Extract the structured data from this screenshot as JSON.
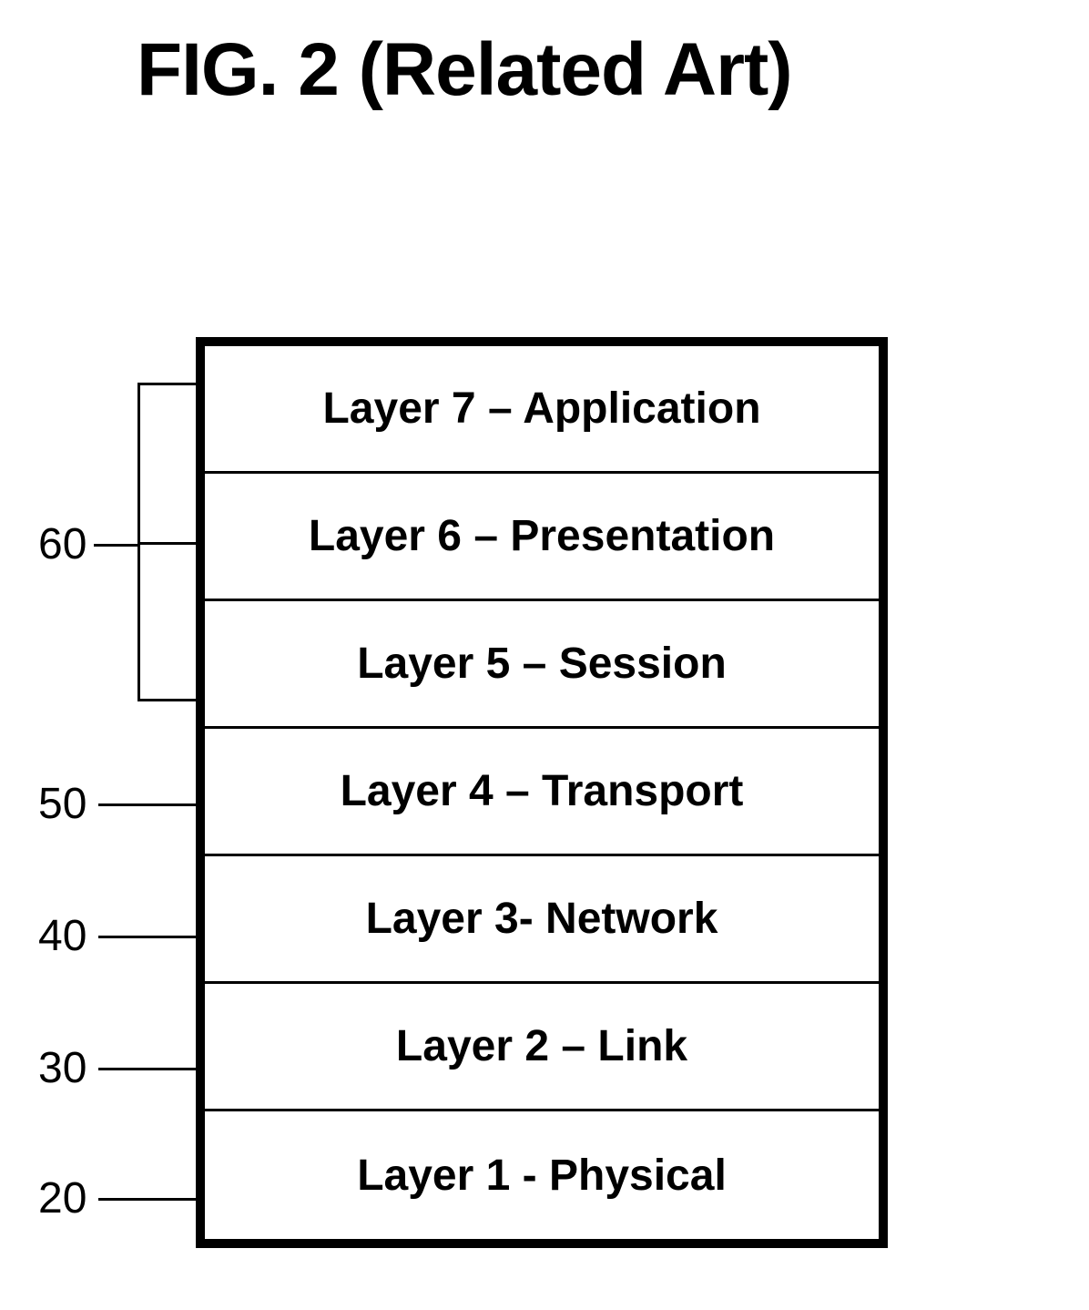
{
  "title": "FIG. 2 (Related Art)",
  "layers": [
    {
      "label": "Layer 7 – Application"
    },
    {
      "label": "Layer 6 – Presentation"
    },
    {
      "label": "Layer 5 – Session"
    },
    {
      "label": "Layer 4 – Transport"
    },
    {
      "label": "Layer 3- Network"
    },
    {
      "label": "Layer 2 – Link"
    },
    {
      "label": "Layer 1 - Physical"
    }
  ],
  "refs": {
    "r60": "60",
    "r50": "50",
    "r40": "40",
    "r30": "30",
    "r20": "20"
  }
}
